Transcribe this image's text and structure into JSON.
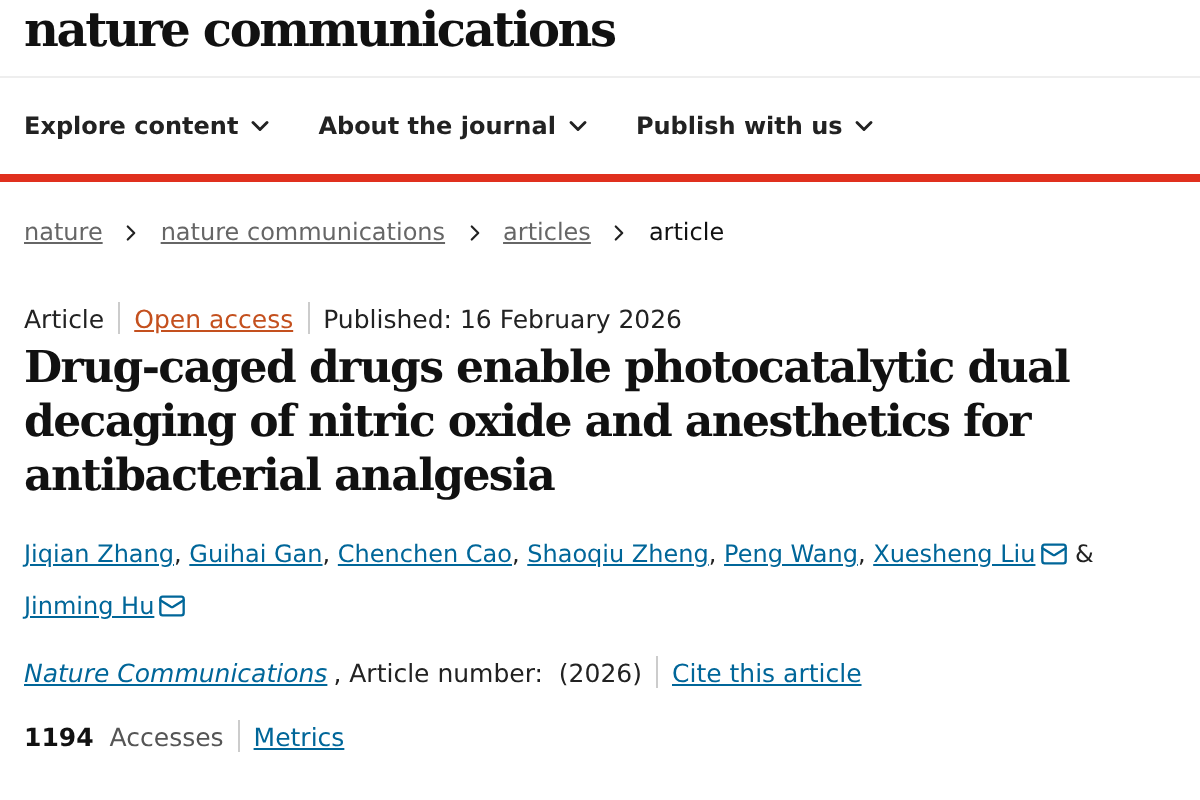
{
  "site": {
    "logo": "nature communications"
  },
  "nav": [
    {
      "label": "Explore content"
    },
    {
      "label": "About the journal"
    },
    {
      "label": "Publish with us"
    }
  ],
  "breadcrumbs": [
    {
      "label": "nature",
      "link": true
    },
    {
      "label": "nature communications",
      "link": true
    },
    {
      "label": "articles",
      "link": true
    },
    {
      "label": "article",
      "link": false
    }
  ],
  "meta": {
    "type": "Article",
    "access": "Open access",
    "published": "Published: 16 February 2026"
  },
  "title": "Drug-caged drugs enable photocatalytic dual decaging of nitric oxide and anesthetics for antibacterial analgesia",
  "authors": [
    {
      "name": "Jiqian Zhang",
      "corresponding": false,
      "after": ","
    },
    {
      "name": "Guihai Gan",
      "corresponding": false,
      "after": ","
    },
    {
      "name": "Chenchen Cao",
      "corresponding": false,
      "after": ","
    },
    {
      "name": "Shaoqiu Zheng",
      "corresponding": false,
      "after": ","
    },
    {
      "name": "Peng Wang",
      "corresponding": false,
      "after": ","
    },
    {
      "name": "Xuesheng Liu",
      "corresponding": true,
      "after": "&"
    },
    {
      "name": "Jinming Hu",
      "corresponding": true
    }
  ],
  "citation": {
    "journal": "Nature Communications",
    "details": ", Article number:  (2026)",
    "cite_link": "Cite this article"
  },
  "metrics": {
    "count": "1194",
    "label": "Accesses",
    "link": "Metrics"
  }
}
